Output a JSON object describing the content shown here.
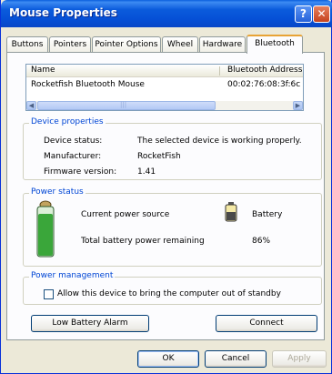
{
  "window": {
    "title": "Mouse Properties",
    "help_glyph": "?",
    "close_glyph": "✕"
  },
  "tabs": [
    "Buttons",
    "Pointers",
    "Pointer Options",
    "Wheel",
    "Hardware",
    "Bluetooth"
  ],
  "active_tab": "Bluetooth",
  "device_list": {
    "columns": [
      "Name",
      "Bluetooth Address"
    ],
    "rows": [
      {
        "name": "Rocketfish Bluetooth Mouse",
        "address": "00:02:76:08:3f:6c"
      }
    ],
    "scroll_left": "◀",
    "scroll_right": "▶",
    "thumb_grip": "|||"
  },
  "device_properties": {
    "title": "Device properties",
    "rows": [
      {
        "label": "Device status:",
        "value": "The selected device is working properly."
      },
      {
        "label": "Manufacturer:",
        "value": "RocketFish"
      },
      {
        "label": "Firmware version:",
        "value": "1.41"
      }
    ]
  },
  "power_status": {
    "title": "Power status",
    "current_source_label": "Current power source",
    "current_source_value": "Battery",
    "remaining_label": "Total battery power remaining",
    "remaining_value": "86%",
    "battery_level": 0.86,
    "battery_color": "#3aa63a"
  },
  "power_management": {
    "title": "Power management",
    "checkbox_label": "Allow this device to bring the computer out of standby",
    "checked": false
  },
  "buttons": {
    "low_battery_alarm": "Low Battery Alarm",
    "connect": "Connect",
    "ok": "OK",
    "cancel": "Cancel",
    "apply": "Apply"
  }
}
